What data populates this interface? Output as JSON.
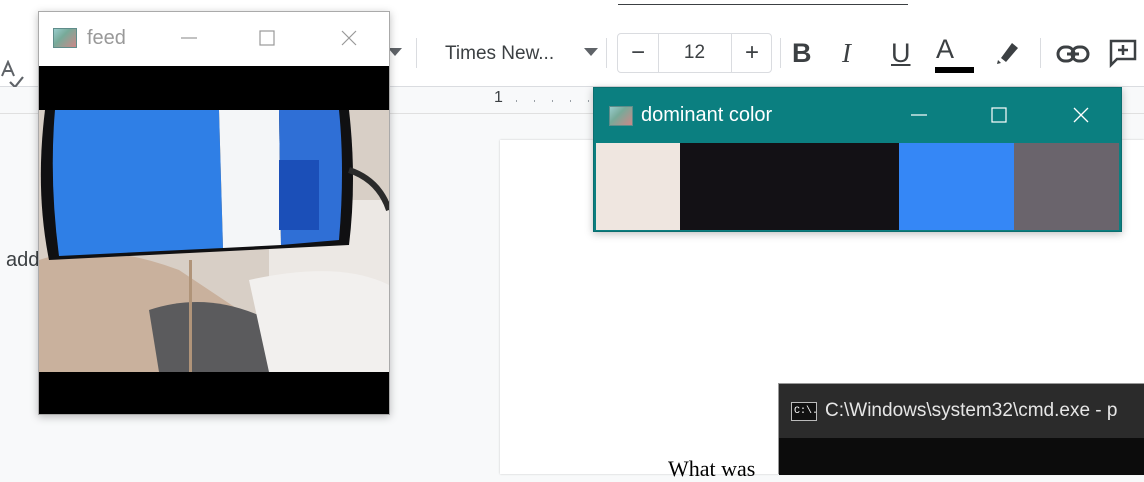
{
  "docs": {
    "font_name": "Times New...",
    "font_size": "12",
    "size_minus": "−",
    "size_plus": "+",
    "bold": "B",
    "italic": "I",
    "underline": "U",
    "text_color": "A",
    "ruler_number": "1",
    "side_text": "add",
    "page_text": "What was"
  },
  "feed_window": {
    "title": "feed"
  },
  "dominant_window": {
    "title": "dominant color",
    "swatches": [
      {
        "color": "#efe6e0",
        "fraction": 0.16
      },
      {
        "color": "#131115",
        "fraction": 0.42
      },
      {
        "color": "#3587f6",
        "fraction": 0.22
      },
      {
        "color": "#6a646c",
        "fraction": 0.2
      }
    ]
  },
  "cmd_window": {
    "title": "C:\\Windows\\system32\\cmd.exe - p",
    "icon_text": "C:\\."
  },
  "colors": {
    "dominant_titlebar": "#0b7f80",
    "cmd_titlebar": "#2b2b2b"
  }
}
